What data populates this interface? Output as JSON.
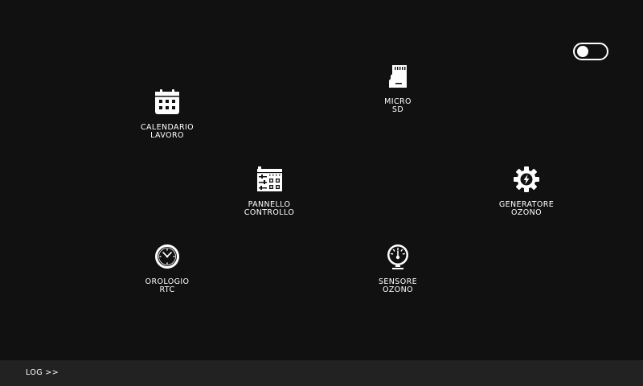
{
  "colors": {
    "background": "#111111",
    "footer_background": "#222222",
    "foreground": "#ffffff"
  },
  "toggle": {
    "state": "off"
  },
  "tiles": {
    "calendario": {
      "line1": "CALENDARIO",
      "line2": "LAVORO",
      "icon": "calendar-icon"
    },
    "micro_sd": {
      "line1": "MICRO",
      "line2": "SD",
      "icon": "sd-card-icon"
    },
    "pannello": {
      "line1": "PANNELLO",
      "line2": "CONTROLLO",
      "icon": "control-panel-icon"
    },
    "generatore": {
      "line1": "GENERATORE",
      "line2": "OZONO",
      "icon": "gear-bolt-icon"
    },
    "orologio": {
      "line1": "OROLOGIO",
      "line2": "RTC",
      "icon": "clock-icon"
    },
    "sensore": {
      "line1": "SENSORE",
      "line2": "OZONO",
      "icon": "gauge-sensor-icon"
    }
  },
  "footer": {
    "log_label": "LOG >>"
  }
}
